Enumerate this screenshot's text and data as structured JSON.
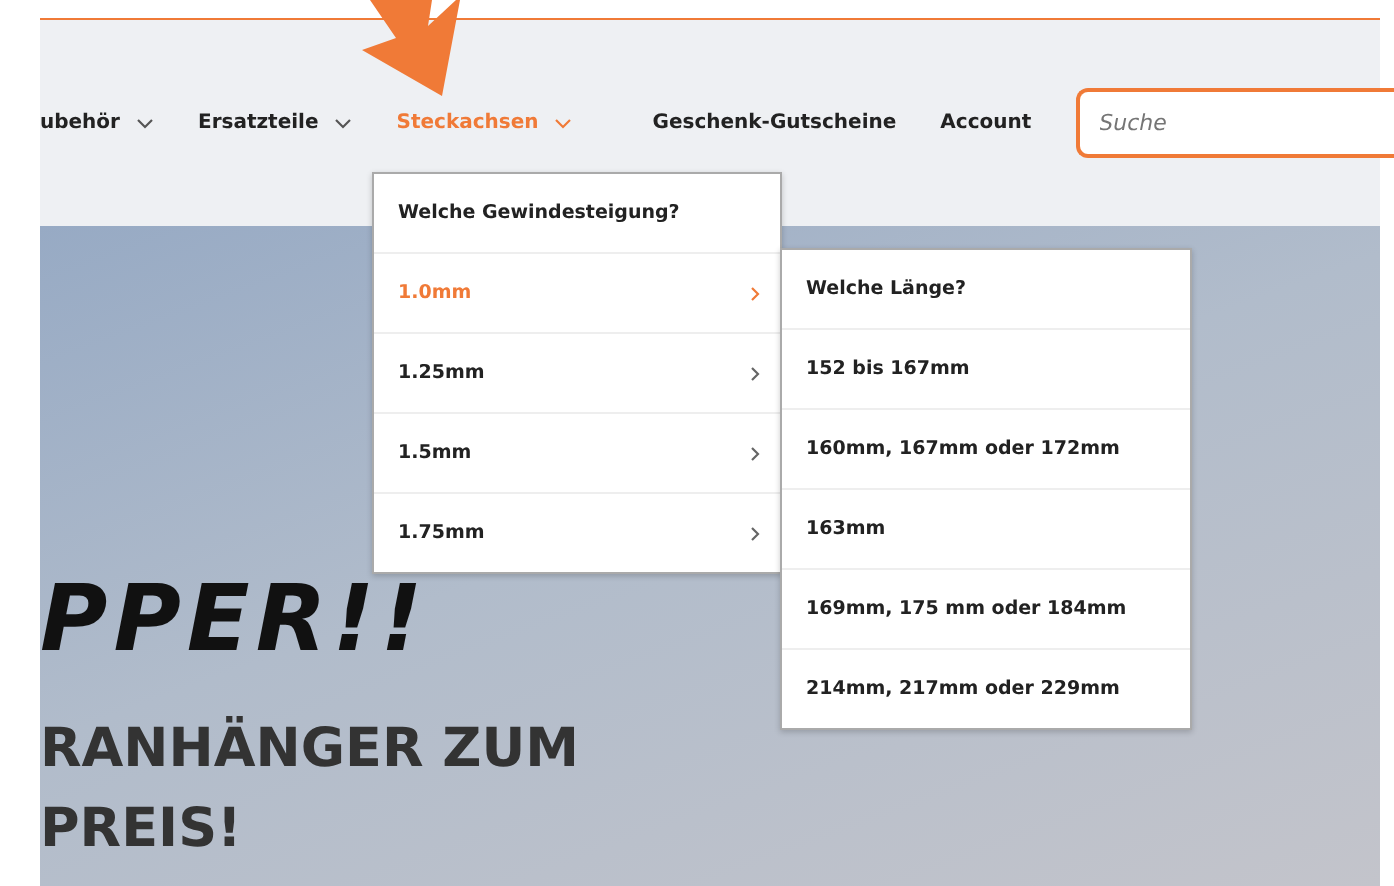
{
  "nav": [
    {
      "label": "ubehör",
      "dropdown": true,
      "selected": false
    },
    {
      "label": "Ersatzteile",
      "dropdown": true,
      "selected": false
    },
    {
      "label": "Steckachsen",
      "dropdown": true,
      "selected": true
    },
    {
      "label": "Geschenk-Gutscheine",
      "dropdown": false,
      "selected": false
    },
    {
      "label": "Account",
      "dropdown": false,
      "selected": false
    }
  ],
  "search": {
    "placeholder": "Suche"
  },
  "menu": {
    "heading": "Welche Gewindesteigung?",
    "items": [
      {
        "label": "1.0mm",
        "selected": true
      },
      {
        "label": "1.25mm",
        "selected": false
      },
      {
        "label": "1.5mm",
        "selected": false
      },
      {
        "label": "1.75mm",
        "selected": false
      }
    ]
  },
  "submenu": {
    "heading": "Welche Länge?",
    "items": [
      "152 bis 167mm",
      "160mm, 167mm oder 172mm",
      "163mm",
      "169mm, 175 mm oder 184mm",
      "214mm, 217mm oder 229mm"
    ]
  },
  "hero": {
    "tagline": "PPER!!",
    "headline": [
      "RANHÄNGER ZUM",
      "PREIS!"
    ]
  }
}
